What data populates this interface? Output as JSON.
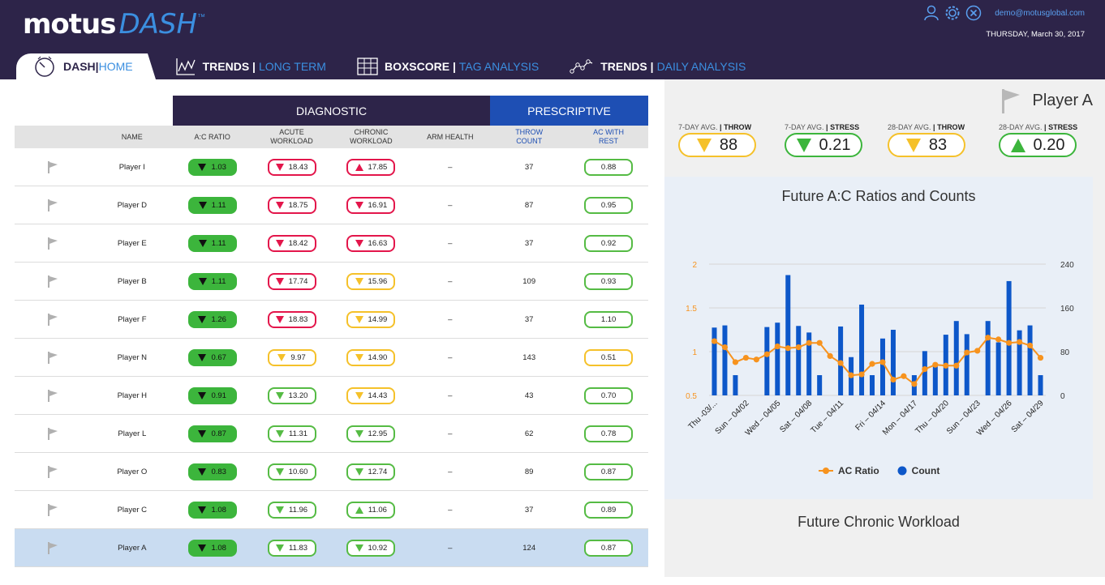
{
  "app": {
    "logo_motus": "motus",
    "logo_dash": "DASH",
    "logo_tm": "™"
  },
  "user": {
    "email": "demo@motusglobal.com",
    "date": "THURSDAY, March 30, 2017"
  },
  "nav": [
    {
      "bold": "DASH|",
      "light": "HOME",
      "icon": "speedometer-icon"
    },
    {
      "bold": "TRENDS |",
      "light": "LONG TERM",
      "icon": "trend-line-icon"
    },
    {
      "bold": "BOXSCORE |",
      "light": "TAG ANALYSIS",
      "icon": "boxscore-grid-icon"
    },
    {
      "bold": "TRENDS |",
      "light": "DAILY ANALYSIS",
      "icon": "daily-trend-icon"
    }
  ],
  "table": {
    "section_diagnostic": "DIAGNOSTIC",
    "section_prescriptive": "PRESCRIPTIVE",
    "headers": {
      "name": "NAME",
      "ac_ratio": "A:C RATIO",
      "acute_1": "ACUTE",
      "acute_2": "WORKLOAD",
      "chronic_1": "CHRONIC",
      "chronic_2": "WORKLOAD",
      "arm": "ARM HEALTH",
      "throw_1": "THROW",
      "throw_2": "COUNT",
      "rest_1": "AC WITH",
      "rest_2": "REST"
    },
    "rows": [
      {
        "name": "Player I",
        "ac": "1.03",
        "acute": "18.43",
        "acute_c": "red",
        "acute_d": "down",
        "chronic": "17.85",
        "chronic_c": "red",
        "chronic_d": "up",
        "arm": "–",
        "throw": "37",
        "rest": "0.88",
        "rest_c": "green"
      },
      {
        "name": "Player D",
        "ac": "1.11",
        "acute": "18.75",
        "acute_c": "red",
        "acute_d": "down",
        "chronic": "16.91",
        "chronic_c": "red",
        "chronic_d": "down",
        "arm": "–",
        "throw": "87",
        "rest": "0.95",
        "rest_c": "green"
      },
      {
        "name": "Player E",
        "ac": "1.11",
        "acute": "18.42",
        "acute_c": "red",
        "acute_d": "down",
        "chronic": "16.63",
        "chronic_c": "red",
        "chronic_d": "down",
        "arm": "–",
        "throw": "37",
        "rest": "0.92",
        "rest_c": "green"
      },
      {
        "name": "Player B",
        "ac": "1.11",
        "acute": "17.74",
        "acute_c": "red",
        "acute_d": "down",
        "chronic": "15.96",
        "chronic_c": "yellow",
        "chronic_d": "down",
        "arm": "–",
        "throw": "109",
        "rest": "0.93",
        "rest_c": "green"
      },
      {
        "name": "Player F",
        "ac": "1.26",
        "acute": "18.83",
        "acute_c": "red",
        "acute_d": "down",
        "chronic": "14.99",
        "chronic_c": "yellow",
        "chronic_d": "down",
        "arm": "–",
        "throw": "37",
        "rest": "1.10",
        "rest_c": "green"
      },
      {
        "name": "Player N",
        "ac": "0.67",
        "acute": "9.97",
        "acute_c": "yellow",
        "acute_d": "down",
        "chronic": "14.90",
        "chronic_c": "yellow",
        "chronic_d": "down",
        "arm": "–",
        "throw": "143",
        "rest": "0.51",
        "rest_c": "yellow"
      },
      {
        "name": "Player H",
        "ac": "0.91",
        "acute": "13.20",
        "acute_c": "green",
        "acute_d": "down",
        "chronic": "14.43",
        "chronic_c": "yellow",
        "chronic_d": "down",
        "arm": "–",
        "throw": "43",
        "rest": "0.70",
        "rest_c": "green"
      },
      {
        "name": "Player L",
        "ac": "0.87",
        "acute": "11.31",
        "acute_c": "green",
        "acute_d": "down",
        "chronic": "12.95",
        "chronic_c": "green",
        "chronic_d": "down",
        "arm": "–",
        "throw": "62",
        "rest": "0.78",
        "rest_c": "green"
      },
      {
        "name": "Player O",
        "ac": "0.83",
        "acute": "10.60",
        "acute_c": "green",
        "acute_d": "down",
        "chronic": "12.74",
        "chronic_c": "green",
        "chronic_d": "down",
        "arm": "–",
        "throw": "89",
        "rest": "0.87",
        "rest_c": "green"
      },
      {
        "name": "Player C",
        "ac": "1.08",
        "acute": "11.96",
        "acute_c": "green",
        "acute_d": "down",
        "chronic": "11.06",
        "chronic_c": "green",
        "chronic_d": "up",
        "arm": "–",
        "throw": "37",
        "rest": "0.89",
        "rest_c": "green"
      },
      {
        "name": "Player A",
        "ac": "1.08",
        "acute": "11.83",
        "acute_c": "green",
        "acute_d": "down",
        "chronic": "10.92",
        "chronic_c": "green",
        "chronic_d": "down",
        "arm": "–",
        "throw": "124",
        "rest": "0.87",
        "rest_c": "green",
        "selected": true
      }
    ]
  },
  "player_panel": {
    "player_name": "Player A",
    "stats": [
      {
        "label_pre": "7-DAY AVG.",
        "label_bold": "| THROW",
        "value": "88",
        "color": "yellow",
        "dir": "down"
      },
      {
        "label_pre": "7-DAY AVG.",
        "label_bold": "| STRESS",
        "value": "0.21",
        "color": "green",
        "dir": "down"
      },
      {
        "label_pre": "28-DAY AVG.",
        "label_bold": "| THROW",
        "value": "83",
        "color": "yellow",
        "dir": "down"
      },
      {
        "label_pre": "28-DAY AVG.",
        "label_bold": "| STRESS",
        "value": "0.20",
        "color": "green",
        "dir": "up"
      }
    ],
    "chart2_title": "Future Chronic Workload"
  },
  "colors": {
    "header": "#2d2449",
    "accent": "#3b8fe0",
    "prescriptive": "#1e4fb4",
    "red": "#e3164b",
    "green": "#3cb53c",
    "yellow": "#f5c12a",
    "bar": "#0d57c9",
    "line": "#f7931e"
  },
  "chart_data": {
    "type": "bar",
    "title": "Future A:C Ratios and Counts",
    "x_tick_labels": [
      "Thu -03/...",
      "Sun – 04/02",
      "Wed – 04/05",
      "Sat – 04/08",
      "Tue – 04/11",
      "Fri – 04/14",
      "Mon – 04/17",
      "Thu – 04/20",
      "Sun – 04/23",
      "Wed – 04/26",
      "Sat – 04/29"
    ],
    "left_axis": {
      "ticks": [
        "0.5",
        "1",
        "1.5",
        "2"
      ],
      "ylim": [
        0.5,
        2
      ]
    },
    "right_axis": {
      "ticks": [
        "0",
        "80",
        "160",
        "240"
      ],
      "ylim": [
        0,
        240
      ]
    },
    "series": [
      {
        "name": "Count",
        "kind": "bar",
        "axis": "right",
        "values": [
          124,
          128,
          37,
          0,
          0,
          125,
          133,
          220,
          127,
          115,
          37,
          0,
          126,
          70,
          166,
          37,
          104,
          120,
          0,
          37,
          81,
          56,
          111,
          136,
          112,
          0,
          136,
          97,
          209,
          119,
          128,
          37
        ]
      },
      {
        "name": "AC Ratio",
        "kind": "line",
        "axis": "left",
        "values": [
          1.12,
          1.05,
          0.88,
          0.93,
          0.91,
          0.97,
          1.06,
          1.04,
          1.05,
          1.1,
          1.1,
          0.95,
          0.87,
          0.73,
          0.74,
          0.86,
          0.88,
          0.68,
          0.72,
          0.63,
          0.8,
          0.85,
          0.84,
          0.84,
          0.99,
          1.01,
          1.16,
          1.14,
          1.1,
          1.11,
          1.07,
          0.93
        ]
      }
    ],
    "legend": [
      "AC Ratio",
      "Count"
    ],
    "legend_position": "bottom"
  }
}
